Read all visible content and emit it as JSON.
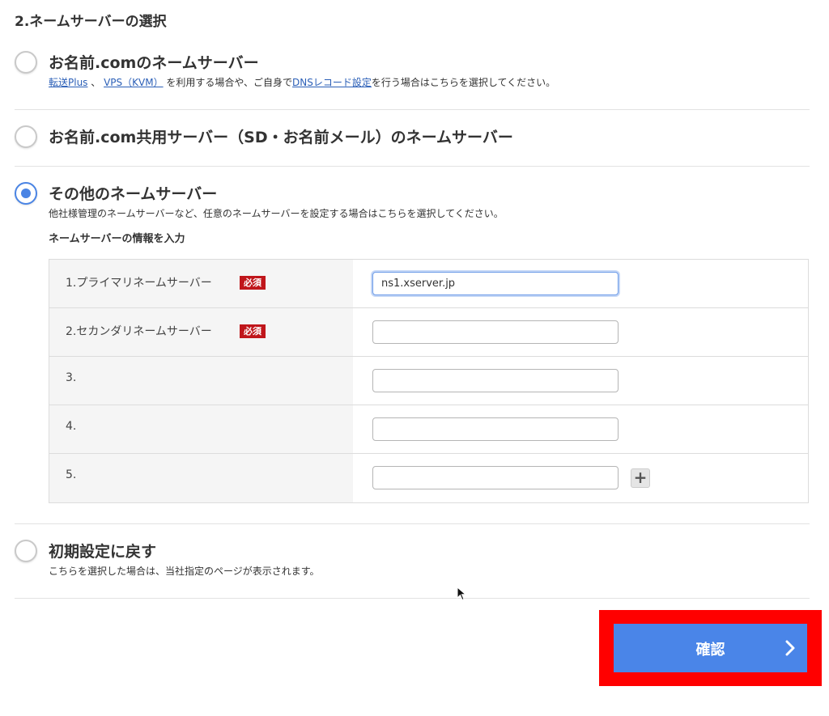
{
  "section_title": "2.ネームサーバーの選択",
  "options": [
    {
      "label": "お名前.comのネームサーバー",
      "desc_links": [
        "転送Plus",
        "VPS（KVM）",
        "DNSレコード設定"
      ],
      "desc_text": [
        " 、 ",
        " を利用する場合や、ご自身で",
        "を行う場合はこちらを選択してください。"
      ],
      "checked": false
    },
    {
      "label": "お名前.com共用サーバー（SD・お名前メール）のネームサーバー",
      "checked": false
    },
    {
      "label": "その他のネームサーバー",
      "desc": "他社様管理のネームサーバーなど、任意のネームサーバーを設定する場合はこちらを選択してください。",
      "checked": true
    },
    {
      "label": "初期設定に戻す",
      "desc": "こちらを選択した場合は、当社指定のページが表示されます。",
      "checked": false
    }
  ],
  "ns_heading": "ネームサーバーの情報を入力",
  "ns_rows": [
    {
      "label": "1.プライマリネームサーバー",
      "required": "必須",
      "value": "ns1.xserver.jp"
    },
    {
      "label": "2.セカンダリネームサーバー",
      "required": "必須",
      "value": ""
    },
    {
      "label": "3.",
      "value": ""
    },
    {
      "label": "4.",
      "value": ""
    },
    {
      "label": "5.",
      "value": ""
    }
  ],
  "plus_label": "+",
  "confirm_label": "確認",
  "colors": {
    "accent": "#4a85e8",
    "required_badge": "#c0161b",
    "highlight": "#ff0000",
    "link": "#2b5fb7"
  },
  "icons": [
    "radio-icon",
    "plus-icon",
    "chevron-right-icon",
    "mouse-cursor-icon"
  ]
}
